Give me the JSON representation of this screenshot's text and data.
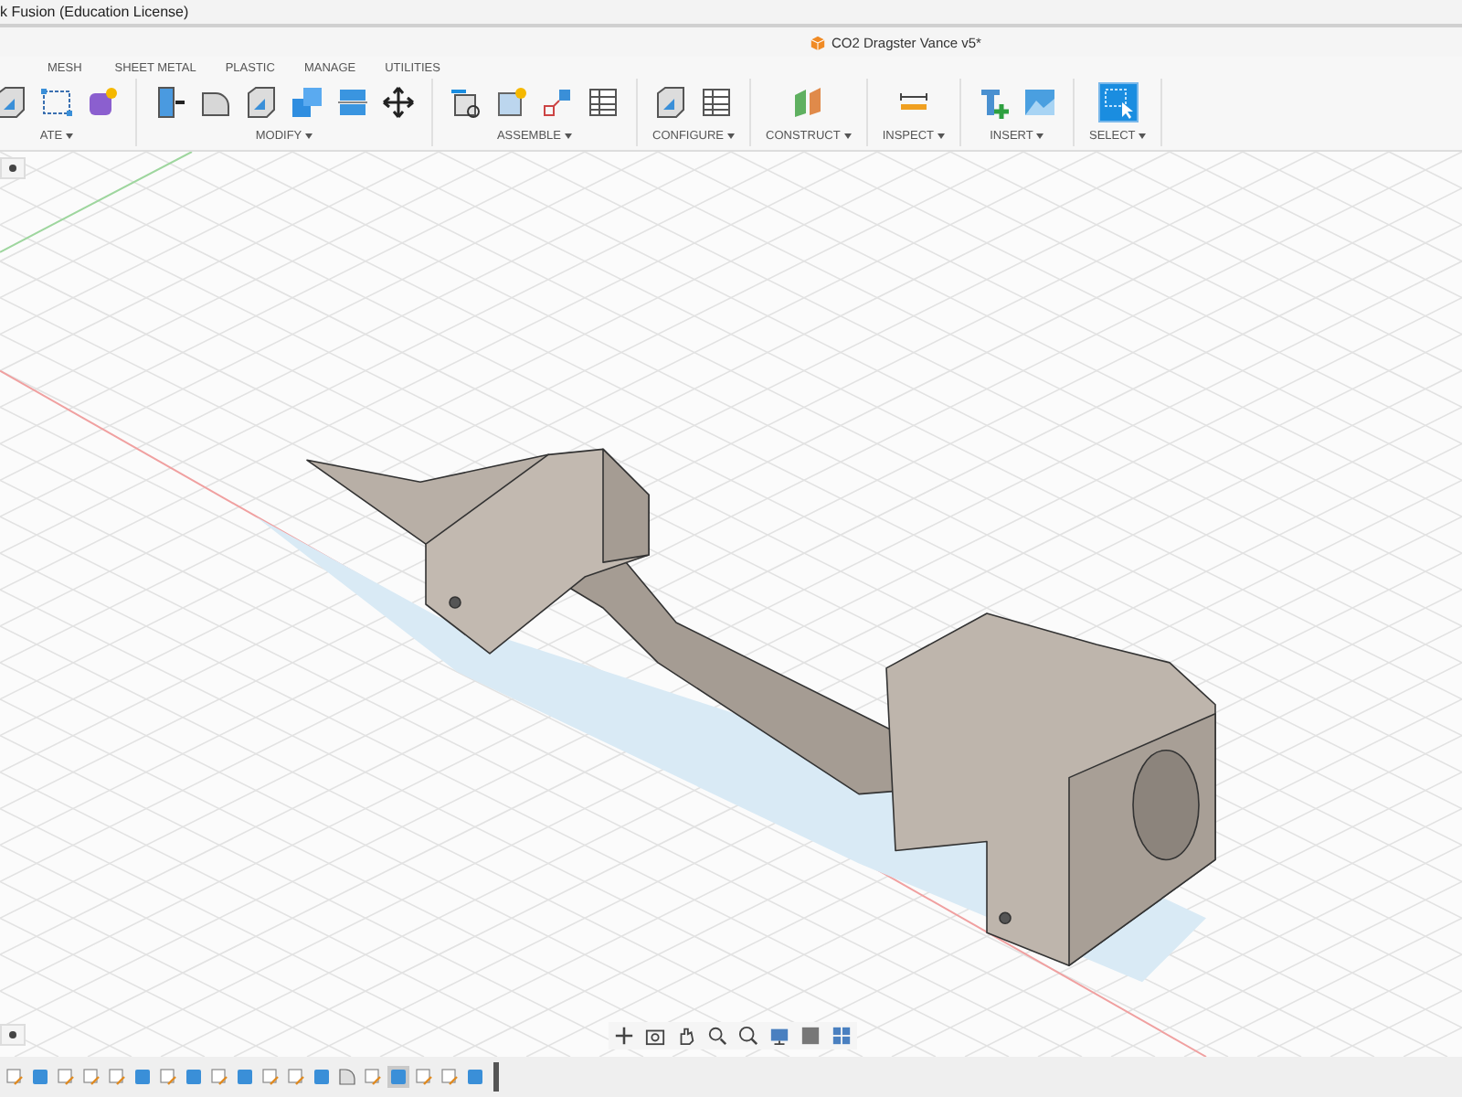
{
  "window": {
    "title": "k Fusion (Education License)"
  },
  "document": {
    "title": "CO2 Dragster Vance v5*"
  },
  "toolbar": {
    "tabs": [
      "MESH",
      "SHEET METAL",
      "PLASTIC",
      "MANAGE",
      "UTILITIES"
    ],
    "groups": [
      {
        "label": "ATE",
        "selected": false
      },
      {
        "label": "MODIFY",
        "selected": false
      },
      {
        "label": "ASSEMBLE",
        "selected": false
      },
      {
        "label": "CONFIGURE",
        "selected": false
      },
      {
        "label": "CONSTRUCT",
        "selected": false
      },
      {
        "label": "INSPECT",
        "selected": false
      },
      {
        "label": "INSERT",
        "selected": false
      },
      {
        "label": "SELECT",
        "selected": true
      }
    ]
  },
  "timeline": {
    "features": [
      {
        "kind": "sketch",
        "selected": false
      },
      {
        "kind": "body",
        "selected": false
      },
      {
        "kind": "sketch",
        "selected": false
      },
      {
        "kind": "sketch",
        "selected": false
      },
      {
        "kind": "sketch",
        "selected": false
      },
      {
        "kind": "body",
        "selected": false
      },
      {
        "kind": "sketch",
        "selected": false
      },
      {
        "kind": "body",
        "selected": false
      },
      {
        "kind": "sketch",
        "selected": false
      },
      {
        "kind": "body",
        "selected": false
      },
      {
        "kind": "sketch",
        "selected": false
      },
      {
        "kind": "sketch",
        "selected": false
      },
      {
        "kind": "body",
        "selected": false
      },
      {
        "kind": "fillet",
        "selected": false
      },
      {
        "kind": "sketch",
        "selected": false
      },
      {
        "kind": "body",
        "selected": true
      },
      {
        "kind": "sketch",
        "selected": false
      },
      {
        "kind": "sketch",
        "selected": false
      },
      {
        "kind": "body",
        "selected": false
      }
    ]
  }
}
